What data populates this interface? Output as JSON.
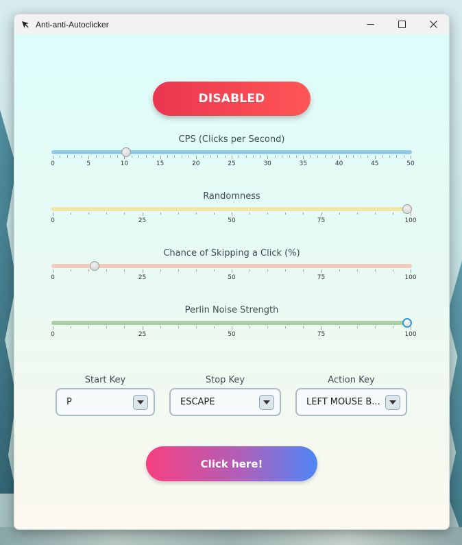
{
  "window": {
    "title": "Anti-anti-Autoclicker",
    "controls": [
      "minimize",
      "maximize",
      "close"
    ]
  },
  "toggle_button": {
    "label": "DISABLED",
    "color_start": "#e9364f",
    "color_end": "#ff5656"
  },
  "sliders": [
    {
      "label": "CPS (Clicks per Second)",
      "min": 0,
      "max": 50,
      "value": 10,
      "track_color": "#8ecbe6",
      "major_ticks": [
        "0",
        "5",
        "10",
        "15",
        "20",
        "25",
        "30",
        "35",
        "40",
        "45",
        "50"
      ]
    },
    {
      "label": "Randomness",
      "min": 0,
      "max": 100,
      "value": 100,
      "track_color": "#f1e6a6",
      "major_ticks": [
        "0",
        "25",
        "50",
        "75",
        "100"
      ]
    },
    {
      "label": "Chance of Skipping a Click (%)",
      "min": 0,
      "max": 100,
      "value": 11,
      "track_color": "#f2cbbd",
      "major_ticks": [
        "0",
        "25",
        "50",
        "75",
        "100"
      ]
    },
    {
      "label": "Perlin Noise Strength",
      "min": 0,
      "max": 100,
      "value": 100,
      "track_color": "#a8cea6",
      "major_ticks": [
        "0",
        "25",
        "50",
        "75",
        "100"
      ],
      "focused": true
    }
  ],
  "keys": {
    "start": {
      "label": "Start Key",
      "value": "P"
    },
    "stop": {
      "label": "Stop Key",
      "value": "ESCAPE"
    },
    "action": {
      "label": "Action Key",
      "value": "LEFT MOUSE B..."
    }
  },
  "click_button": {
    "label": "Click here!"
  }
}
